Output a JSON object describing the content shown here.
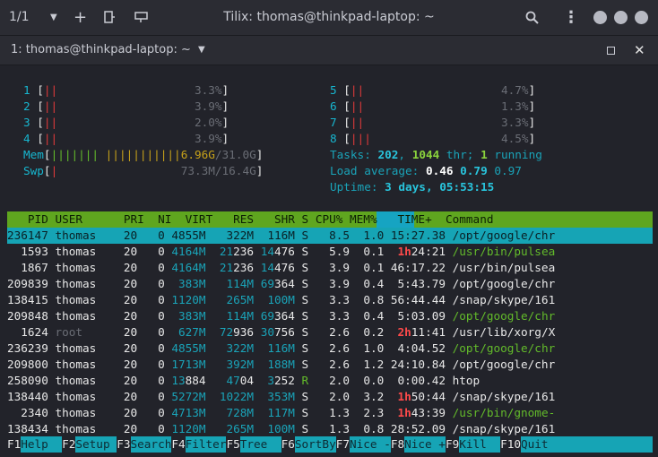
{
  "window": {
    "title": "Tilix: thomas@thinkpad-laptop: ~",
    "session_counter": "1/1",
    "tab_title": "1: thomas@thinkpad-laptop: ~"
  },
  "cpu_meters": [
    {
      "label": "1",
      "bar": "||",
      "value": "3.3%"
    },
    {
      "label": "2",
      "bar": "||",
      "value": "3.9%"
    },
    {
      "label": "3",
      "bar": "||",
      "value": "2.0%"
    },
    {
      "label": "4",
      "bar": "||",
      "value": "3.9%"
    },
    {
      "label": "5",
      "bar": "||",
      "value": "4.7%"
    },
    {
      "label": "6",
      "bar": "||",
      "value": "1.3%"
    },
    {
      "label": "7",
      "bar": "||",
      "value": "3.3%"
    },
    {
      "label": "8",
      "bar": "|||",
      "value": "4.5%"
    }
  ],
  "mem": {
    "label": "Mem",
    "bar_green": "||||||| ",
    "bar_yellow": "|||||||||||",
    "value_used": "6.96G",
    "value_total": "/31.0G"
  },
  "swp": {
    "label": "Swp",
    "value": "73.3M/16.4G"
  },
  "summary": {
    "tasks_label": "Tasks: ",
    "tasks": "202",
    "thr_sep": ", ",
    "thr": "1044",
    "thr_label": " thr; ",
    "running": "1",
    "running_label": " running",
    "load_label": "Load average: ",
    "load1": "0.46",
    "load5": "0.79",
    "load15": "0.97",
    "uptime_label": "Uptime: ",
    "uptime": "3 days, 05:53:15"
  },
  "columns": {
    "pid": "PID",
    "user": "USER",
    "pri": "PRI",
    "ni": "NI",
    "virt": "VIRT",
    "res": "RES",
    "shr": "SHR",
    "s": "S",
    "cpu": "CPU%",
    "mem": "MEM%",
    "time": "TIME+",
    "command": "Command"
  },
  "processes": [
    {
      "pid": "236147",
      "user": "thomas",
      "pri": "20",
      "ni": "0",
      "virt": "4855M",
      "res": "322M",
      "shr": "116M",
      "s": "S",
      "cpu": "8.5",
      "mem": "1.0",
      "time": "15:27.38",
      "cmd": "/opt/google/chr"
    },
    {
      "pid": "1593",
      "user": "thomas",
      "pri": "20",
      "ni": "0",
      "virt": "4164M",
      "res": "21236",
      "shr": "14476",
      "s": "S",
      "cpu": "5.9",
      "mem": "0.1",
      "time": "1h24:21",
      "cmd": "/usr/bin/pulsea"
    },
    {
      "pid": "1867",
      "user": "thomas",
      "pri": "20",
      "ni": "0",
      "virt": "4164M",
      "res": "21236",
      "shr": "14476",
      "s": "S",
      "cpu": "3.9",
      "mem": "0.1",
      "time": "46:17.22",
      "cmd": "/usr/bin/pulsea"
    },
    {
      "pid": "209839",
      "user": "thomas",
      "pri": "20",
      "ni": "0",
      "virt": "383M",
      "res": "114M",
      "shr": "69364",
      "s": "S",
      "cpu": "3.9",
      "mem": "0.4",
      "time": "5:43.79",
      "cmd": "/opt/google/chr"
    },
    {
      "pid": "138415",
      "user": "thomas",
      "pri": "20",
      "ni": "0",
      "virt": "1120M",
      "res": "265M",
      "shr": "100M",
      "s": "S",
      "cpu": "3.3",
      "mem": "0.8",
      "time": "56:44.44",
      "cmd": "/snap/skype/161"
    },
    {
      "pid": "209848",
      "user": "thomas",
      "pri": "20",
      "ni": "0",
      "virt": "383M",
      "res": "114M",
      "shr": "69364",
      "s": "S",
      "cpu": "3.3",
      "mem": "0.4",
      "time": "5:03.09",
      "cmd": "/opt/google/chr"
    },
    {
      "pid": "1624",
      "user": "root",
      "pri": "20",
      "ni": "0",
      "virt": "627M",
      "res": "72936",
      "shr": "30756",
      "s": "S",
      "cpu": "2.6",
      "mem": "0.2",
      "time": "2h11:41",
      "cmd": "/usr/lib/xorg/X"
    },
    {
      "pid": "236239",
      "user": "thomas",
      "pri": "20",
      "ni": "0",
      "virt": "4855M",
      "res": "322M",
      "shr": "116M",
      "s": "S",
      "cpu": "2.6",
      "mem": "1.0",
      "time": "4:04.52",
      "cmd": "/opt/google/chr"
    },
    {
      "pid": "209800",
      "user": "thomas",
      "pri": "20",
      "ni": "0",
      "virt": "1713M",
      "res": "392M",
      "shr": "188M",
      "s": "S",
      "cpu": "2.6",
      "mem": "1.2",
      "time": "24:10.84",
      "cmd": "/opt/google/chr"
    },
    {
      "pid": "258090",
      "user": "thomas",
      "pri": "20",
      "ni": "0",
      "virt": "13884",
      "res": "4704",
      "shr": "3252",
      "s": "R",
      "cpu": "2.0",
      "mem": "0.0",
      "time": "0:00.42",
      "cmd": "htop"
    },
    {
      "pid": "138440",
      "user": "thomas",
      "pri": "20",
      "ni": "0",
      "virt": "5272M",
      "res": "1022M",
      "shr": "353M",
      "s": "S",
      "cpu": "2.0",
      "mem": "3.2",
      "time": "1h50:44",
      "cmd": "/snap/skype/161"
    },
    {
      "pid": "2340",
      "user": "thomas",
      "pri": "20",
      "ni": "0",
      "virt": "4713M",
      "res": "728M",
      "shr": "117M",
      "s": "S",
      "cpu": "1.3",
      "mem": "2.3",
      "time": "1h43:39",
      "cmd": "/usr/bin/gnome-"
    },
    {
      "pid": "138434",
      "user": "thomas",
      "pri": "20",
      "ni": "0",
      "virt": "1120M",
      "res": "265M",
      "shr": "100M",
      "s": "S",
      "cpu": "1.3",
      "mem": "0.8",
      "time": "28:52.09",
      "cmd": "/snap/skype/161"
    }
  ],
  "function_keys": [
    {
      "key": "F1",
      "label": "Help  "
    },
    {
      "key": "F2",
      "label": "Setup "
    },
    {
      "key": "F3",
      "label": "Search"
    },
    {
      "key": "F4",
      "label": "Filter"
    },
    {
      "key": "F5",
      "label": "Tree  "
    },
    {
      "key": "F6",
      "label": "SortBy"
    },
    {
      "key": "F7",
      "label": "Nice -"
    },
    {
      "key": "F8",
      "label": "Nice +"
    },
    {
      "key": "F9",
      "label": "Kill  "
    },
    {
      "key": "F10",
      "label": "Quit"
    }
  ]
}
